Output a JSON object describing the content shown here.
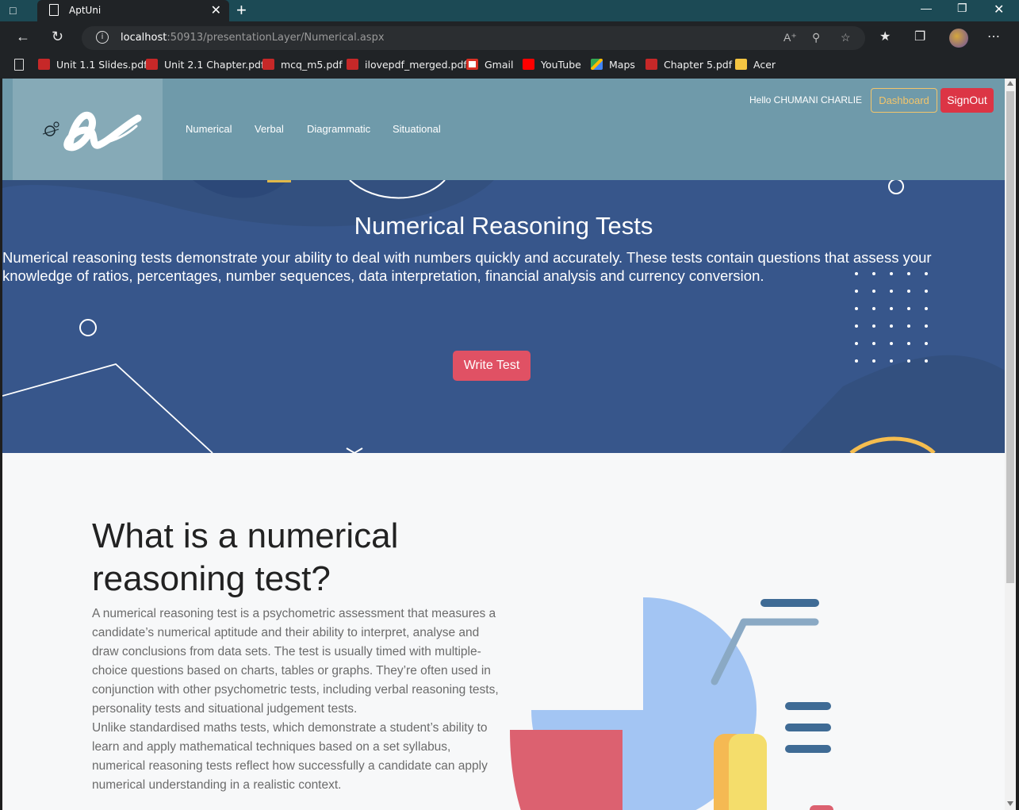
{
  "browser": {
    "tab_title": "AptUni",
    "url_host": "localhost",
    "url_rest": ":50913/presentationLayer/Numerical.aspx",
    "bookmarks": [
      {
        "label": "Unit 1.1 Slides.pdf",
        "icon": "pdf-icon"
      },
      {
        "label": "Unit 2.1 Chapter.pdf",
        "icon": "pdf-icon"
      },
      {
        "label": "mcq_m5.pdf",
        "icon": "pdf-icon"
      },
      {
        "label": "ilovepdf_merged.pdf",
        "icon": "pdf-icon"
      },
      {
        "label": "Gmail",
        "icon": "gmail-icon"
      },
      {
        "label": "YouTube",
        "icon": "youtube-icon"
      },
      {
        "label": "Maps",
        "icon": "maps-icon"
      },
      {
        "label": "Chapter 5.pdf",
        "icon": "pdf-icon"
      },
      {
        "label": "Acer",
        "icon": "folder-icon"
      }
    ]
  },
  "header": {
    "nav": [
      "Numerical",
      "Verbal",
      "Diagrammatic",
      "Situational"
    ],
    "greeting": "Hello CHUMANI CHARLIE",
    "dashboard_label": "Dashboard",
    "signout_label": "SignOut"
  },
  "hero": {
    "title": "Numerical Reasoning Tests",
    "text": "Numerical reasoning tests demonstrate your ability to deal with numbers quickly and accurately. These tests contain questions that assess your knowledge of ratios, percentages, number sequences, data interpretation, financial analysis and currency conversion.",
    "button_label": "Write Test"
  },
  "section": {
    "heading": "What is a numerical reasoning test?",
    "paragraph1": "A numerical reasoning test is a psychometric assessment that measures a candidate’s numerical aptitude and their ability to interpret, analyse and draw conclusions from data sets. The test is usually timed with multiple-choice questions based on charts, tables or graphs. They’re often used in conjunction with other psychometric tests, including verbal reasoning tests, personality tests and situational judgement tests.",
    "paragraph2": "Unlike standardised maths tests, which demonstrate a student’s ability to learn and apply mathematical techniques based on a set syllabus, numerical reasoning tests reflect how successfully a candidate can apply numerical understanding in a realistic context."
  },
  "colors": {
    "header_bg": "#6f9aaa",
    "hero_bg": "#37568b",
    "accent_red": "#dc3545",
    "dashboard_outline": "#f3c56b"
  }
}
